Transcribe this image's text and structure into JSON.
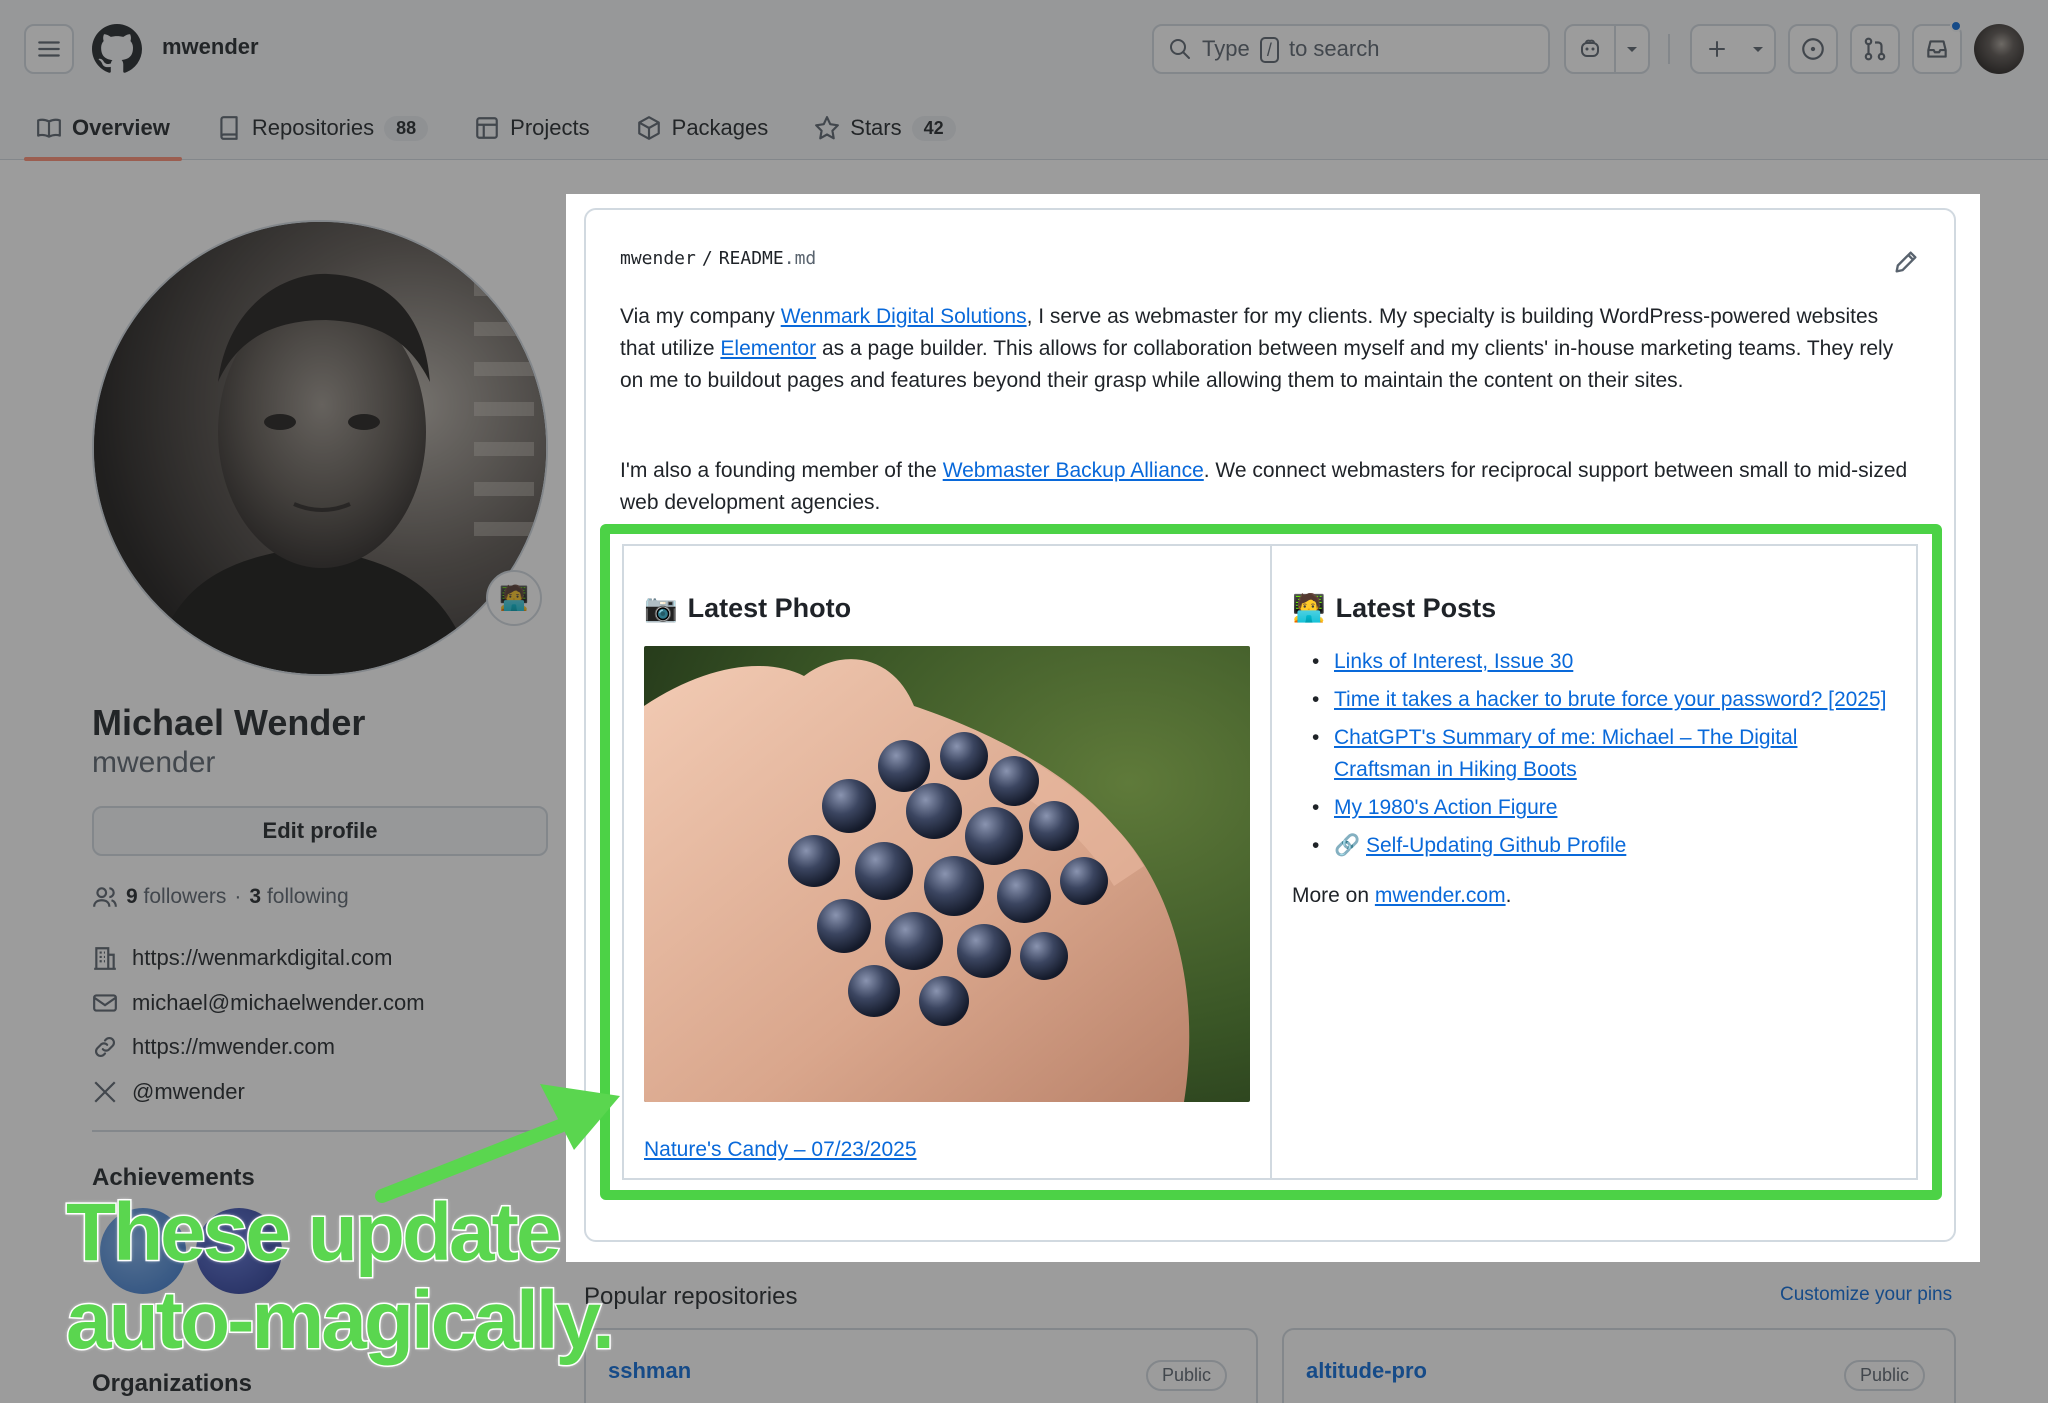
{
  "header": {
    "username": "mwender",
    "search_prefix": "Type",
    "search_key": "/",
    "search_suffix": "to search"
  },
  "tabs": [
    {
      "label": "Overview",
      "active": true
    },
    {
      "label": "Repositories",
      "count": "88"
    },
    {
      "label": "Projects"
    },
    {
      "label": "Packages"
    },
    {
      "label": "Stars",
      "count": "42"
    }
  ],
  "profile": {
    "status_emoji": "🧑‍💻",
    "name": "Michael Wender",
    "login": "mwender",
    "edit_label": "Edit profile",
    "followers_count": "9",
    "followers_label": "followers",
    "dot": "·",
    "following_count": "3",
    "following_label": "following",
    "website": "https://wenmarkdigital.com",
    "email": "michael@michaelwender.com",
    "link": "https://mwender.com",
    "social": "@mwender",
    "achievements": "Achievements",
    "organizations": "Organizations"
  },
  "readme": {
    "owner": "mwender",
    "sep": "/",
    "file": "README",
    "ext": ".md",
    "p1_a": "Via my company ",
    "p1_link1": "Wenmark Digital Solutions",
    "p1_b": ", I serve as webmaster for my clients. My specialty is building WordPress-powered websites that utilize ",
    "p1_link2": "Elementor",
    "p1_c": " as a page builder. This allows for collaboration between myself and my clients' in-house marketing teams. They rely on me to buildout pages and features beyond their grasp while allowing them to maintain the content on their sites.",
    "p2_a": "I'm also a founding member of the ",
    "p2_link": "Webmaster Backup Alliance",
    "p2_b": ". We connect webmasters for reciprocal support between small to mid-sized web development agencies.",
    "photo_emoji": "📷",
    "photo_heading": "Latest Photo",
    "photo_caption": "Nature's Candy – 07/23/2025",
    "posts_emoji": "🧑‍💻",
    "posts_heading": "Latest Posts",
    "posts": [
      "Links of Interest, Issue 30",
      "Time it takes a hacker to brute force your password? [2025]",
      "ChatGPT's Summary of me: Michael – The Digital Craftsman in Hiking Boots",
      "My 1980's Action Figure",
      "Self-Updating Github Profile"
    ],
    "last_post_emoji": "🔗",
    "more_prefix": "More on ",
    "more_link": "mwender.com",
    "more_suffix": "."
  },
  "popular": {
    "heading": "Popular repositories",
    "customize": "Customize your pins",
    "repos": [
      {
        "name": "sshman",
        "visibility": "Public"
      },
      {
        "name": "altitude-pro",
        "visibility": "Public"
      }
    ]
  },
  "annotation": {
    "line1": "These update",
    "line2": "auto-magically."
  },
  "colors": {
    "highlight": "#4cd246",
    "link": "#0969da",
    "tab_underline": "#fd8c73"
  }
}
